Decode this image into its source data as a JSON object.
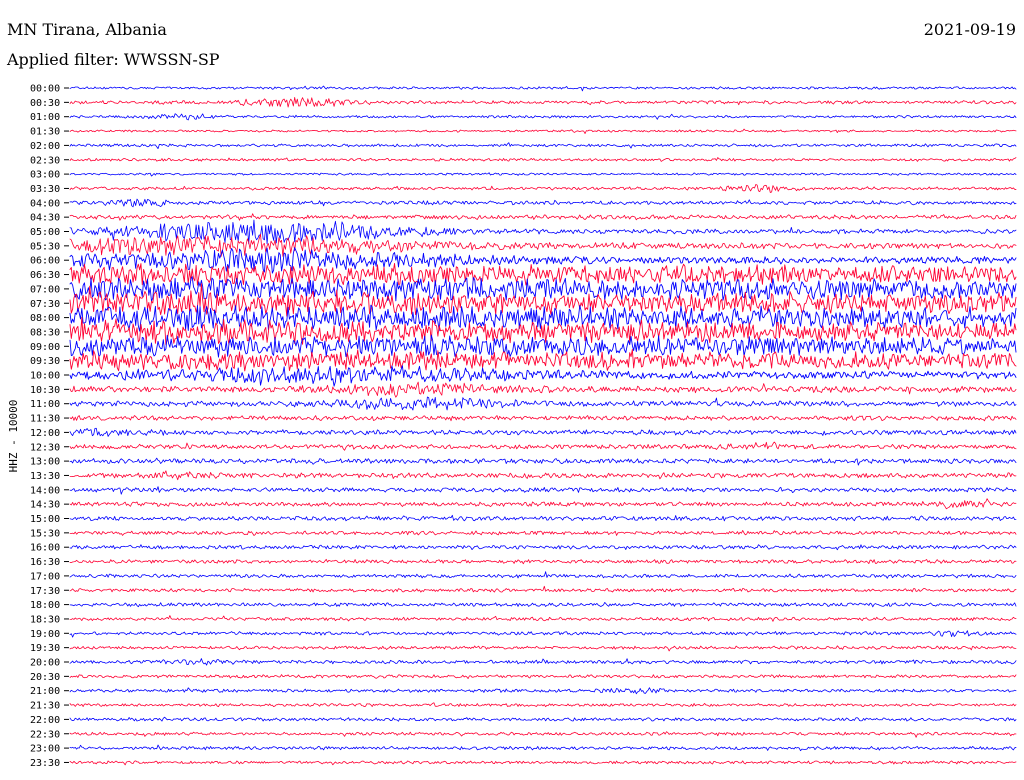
{
  "header": {
    "station": "MN Tirana, Albania",
    "date": "2021-09-19",
    "filter": "Applied filter: WWSSN-SP"
  },
  "chart_data": {
    "type": "line",
    "title": "MN Tirana, Albania",
    "subtitle": "Applied filter: WWSSN-SP",
    "ylabel": "HHZ - 10000",
    "date": "2021-09-19",
    "row_labels": [
      "00:00",
      "00:30",
      "01:00",
      "01:30",
      "02:00",
      "02:30",
      "03:00",
      "03:30",
      "04:00",
      "04:30",
      "05:00",
      "05:30",
      "06:00",
      "06:30",
      "07:00",
      "07:30",
      "08:00",
      "08:30",
      "09:00",
      "09:30",
      "10:00",
      "10:30",
      "11:00",
      "11:30",
      "12:00",
      "12:30",
      "13:00",
      "13:30",
      "14:00",
      "14:30",
      "15:00",
      "15:30",
      "16:00",
      "16:30",
      "17:00",
      "17:30",
      "18:00",
      "18:30",
      "19:00",
      "19:30",
      "20:00",
      "20:30",
      "21:00",
      "21:30",
      "22:00",
      "22:30",
      "23:00",
      "23:30"
    ],
    "series_colors": [
      "#0000ff",
      "#ff0033"
    ],
    "amplitude": [
      0.9,
      1.2,
      0.9,
      0.8,
      1.1,
      1.0,
      0.8,
      1.1,
      1.4,
      1.6,
      1.7,
      2.1,
      2.6,
      3.4,
      3.8,
      3.9,
      4.0,
      3.8,
      3.6,
      3.2,
      2.8,
      2.3,
      2.0,
      1.7,
      1.8,
      1.7,
      1.8,
      1.8,
      1.7,
      1.6,
      1.6,
      1.4,
      1.4,
      1.4,
      1.3,
      1.3,
      1.3,
      1.2,
      1.2,
      1.2,
      1.3,
      1.2,
      1.2,
      1.1,
      1.2,
      1.1,
      1.2,
      1.1
    ],
    "events": [
      {
        "time": "00:30",
        "minute": 7.1,
        "duration": 1.1,
        "strength": 3.2
      },
      {
        "time": "01:00",
        "minute": 3.6,
        "duration": 0.9,
        "strength": 1.7
      },
      {
        "time": "03:30",
        "minute": 21.8,
        "duration": 0.8,
        "strength": 1.8
      },
      {
        "time": "04:00",
        "minute": 2.2,
        "duration": 0.7,
        "strength": 1.9
      },
      {
        "time": "05:00",
        "minute": 6.0,
        "duration": 3.2,
        "strength": 7.5
      },
      {
        "time": "05:30",
        "minute": 4.5,
        "duration": 4.8,
        "strength": 5.8
      },
      {
        "time": "06:00",
        "minute": 6.0,
        "duration": 4.0,
        "strength": 6.4
      },
      {
        "time": "06:30",
        "minute": 0.0,
        "duration": 30.0,
        "strength": 4.5
      },
      {
        "time": "07:00",
        "minute": 0.0,
        "duration": 30.0,
        "strength": 4.8
      },
      {
        "time": "07:30",
        "minute": 0.0,
        "duration": 30.0,
        "strength": 5.1
      },
      {
        "time": "08:00",
        "minute": 0.0,
        "duration": 30.0,
        "strength": 5.0
      },
      {
        "time": "08:30",
        "minute": 0.0,
        "duration": 30.0,
        "strength": 4.8
      },
      {
        "time": "09:00",
        "minute": 0.0,
        "duration": 30.0,
        "strength": 4.4
      },
      {
        "time": "09:30",
        "minute": 0.0,
        "duration": 30.0,
        "strength": 4.2
      },
      {
        "time": "10:00",
        "minute": 7.8,
        "duration": 4.2,
        "strength": 4.6
      },
      {
        "time": "10:30",
        "minute": 11.0,
        "duration": 1.8,
        "strength": 3.1
      },
      {
        "time": "11:00",
        "minute": 11.0,
        "duration": 1.8,
        "strength": 3.6
      },
      {
        "time": "12:00",
        "minute": 1.1,
        "duration": 1.0,
        "strength": 1.7
      },
      {
        "time": "12:30",
        "minute": 22.1,
        "duration": 0.7,
        "strength": 2.0
      },
      {
        "time": "13:30",
        "minute": 3.5,
        "duration": 0.7,
        "strength": 1.9
      },
      {
        "time": "14:30",
        "minute": 28.3,
        "duration": 0.6,
        "strength": 2.3
      },
      {
        "time": "19:00",
        "minute": 28.1,
        "duration": 0.6,
        "strength": 1.6
      },
      {
        "time": "20:00",
        "minute": 4.1,
        "duration": 0.8,
        "strength": 1.5
      },
      {
        "time": "21:00",
        "minute": 17.8,
        "duration": 0.6,
        "strength": 1.6
      }
    ],
    "grid": false,
    "legend": "none"
  }
}
